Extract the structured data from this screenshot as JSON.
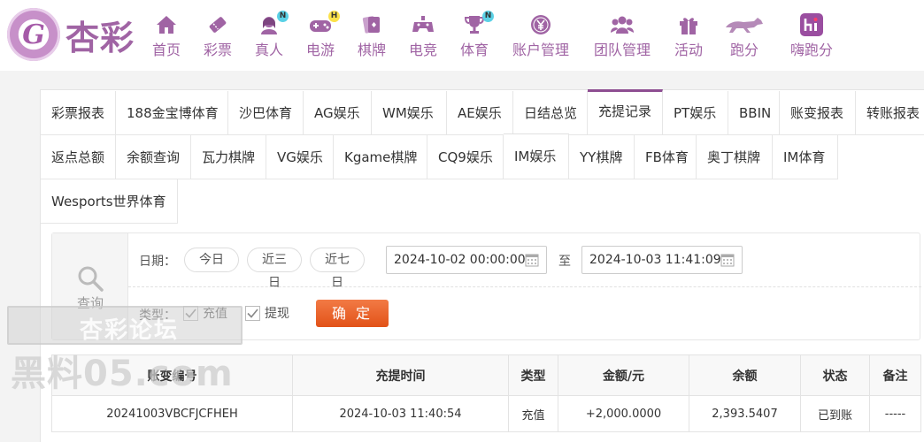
{
  "brand": {
    "logo_text": "杏彩",
    "logo_mark": "G",
    "color": "#a064a4"
  },
  "nav": [
    {
      "label": "首页",
      "icon": "home-icon"
    },
    {
      "label": "彩票",
      "icon": "lottery-ticket-icon"
    },
    {
      "label": "真人",
      "icon": "live-dealer-icon",
      "badge": "N"
    },
    {
      "label": "电游",
      "icon": "gamepad-icon",
      "badge": "H"
    },
    {
      "label": "棋牌",
      "icon": "cards-icon"
    },
    {
      "label": "电竞",
      "icon": "esports-controller-icon"
    },
    {
      "label": "体育",
      "icon": "trophy-icon",
      "badge": "N"
    },
    {
      "label": "账户管理",
      "icon": "account-coin-icon"
    },
    {
      "label": "团队管理",
      "icon": "team-icon"
    },
    {
      "label": "活动",
      "icon": "gift-icon"
    },
    {
      "label": "跑分",
      "icon": "racing-dog-icon"
    },
    {
      "label": "嗨跑分",
      "icon": "hi-app-icon"
    }
  ],
  "tabs": [
    {
      "label": "彩票报表"
    },
    {
      "label": "188金宝博体育"
    },
    {
      "label": "沙巴体育"
    },
    {
      "label": "AG娱乐"
    },
    {
      "label": "WM娱乐"
    },
    {
      "label": "AE娱乐"
    },
    {
      "label": "日结总览"
    },
    {
      "label": "充提记录",
      "active": true
    },
    {
      "label": "PT娱乐"
    },
    {
      "label": "BBIN"
    },
    {
      "label": "账变报表"
    },
    {
      "label": "转账报表"
    },
    {
      "label": "返点总额"
    },
    {
      "label": "余额查询"
    },
    {
      "label": "瓦力棋牌"
    },
    {
      "label": "VG娱乐"
    },
    {
      "label": "Kgame棋牌"
    },
    {
      "label": "CQ9娱乐"
    },
    {
      "label": "IM娱乐"
    },
    {
      "label": "YY棋牌"
    },
    {
      "label": "FB体育"
    },
    {
      "label": "奥丁棋牌"
    },
    {
      "label": "IM体育"
    },
    {
      "label": "Wesports世界体育"
    }
  ],
  "query": {
    "side_label": "查询",
    "date_label": "日期：",
    "quick_ranges": [
      "今日",
      "近三日",
      "近七日"
    ],
    "start_date": "2024-10-02 00:00:00",
    "to_label": "至",
    "end_date": "2024-10-03 11:41:09",
    "type_label": "类型：",
    "types": [
      {
        "label": "充值",
        "checked": true
      },
      {
        "label": "提现",
        "checked": true
      }
    ],
    "confirm_label": "确 定",
    "confirm_color": "#e95a22"
  },
  "table": {
    "headers": [
      "账变编号",
      "充提时间",
      "类型",
      "金额/元",
      "余额",
      "状态",
      "备注"
    ],
    "rows": [
      {
        "id": "20241003VBCFJCFHEH",
        "time": "2024-10-03 11:40:54",
        "type": "充值",
        "amount": "+2,000.0000",
        "balance": "2,393.5407",
        "status": "已到账",
        "note": "-----"
      }
    ]
  },
  "watermark": {
    "top": "杏彩论坛",
    "bottom": "黑料05.com"
  }
}
